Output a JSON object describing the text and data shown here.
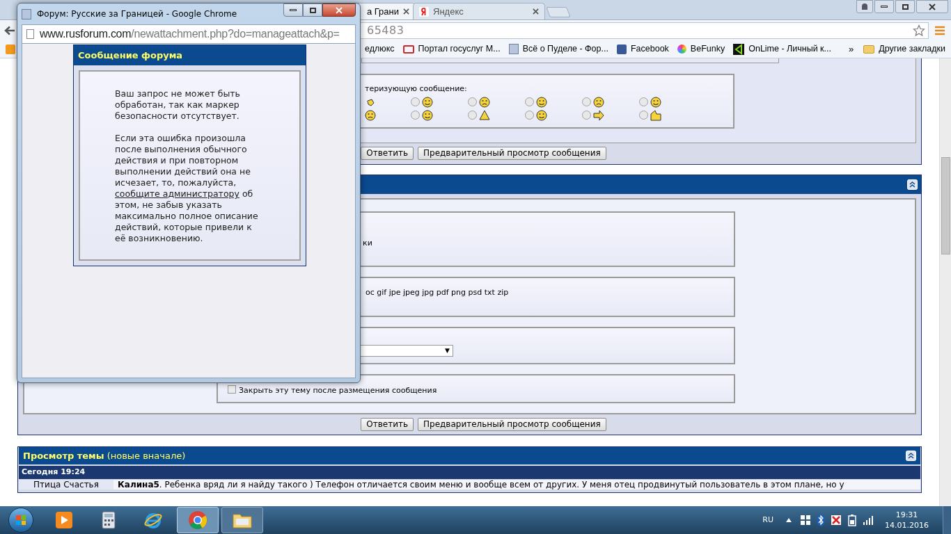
{
  "browser": {
    "tabs": [
      {
        "label": "а Грани",
        "selected": true
      },
      {
        "label": "Яндекс",
        "selected": false
      }
    ],
    "address": "65483",
    "bookmarks": [
      {
        "label": "едлюкс"
      },
      {
        "label": "Портал госуслуг М..."
      },
      {
        "label": "Всё о Пуделе - Фор..."
      },
      {
        "label": "Facebook"
      },
      {
        "label": "BeFunky"
      },
      {
        "label": "OnLime - Личный к..."
      }
    ],
    "bookmarks_more": "»",
    "other_bookmarks": "Другие закладки"
  },
  "reply_form": {
    "smilies_label": "теризующую сообщение:",
    "smilie_radios": [
      {
        "selected": false
      },
      {
        "selected": false
      },
      {
        "selected": false
      },
      {
        "selected": false
      },
      {
        "selected": false
      },
      {
        "selected": false
      },
      {
        "selected": false
      },
      {
        "selected": false
      },
      {
        "selected": false
      },
      {
        "selected": false
      }
    ],
    "buttons": [
      "Ответить",
      "Предварительный просмотр сообщения"
    ]
  },
  "options_panel": {
    "fieldset_1": "ки",
    "fieldset_2": "oc gif jpe jpeg jpg pdf png psd txt zip",
    "select_caret": "▼",
    "close_thread": {
      "label": "Закрыть эту тему после размещения сообщения",
      "checked": false
    },
    "buttons": [
      "Ответить",
      "Предварительный просмотр сообщения"
    ]
  },
  "thread_review": {
    "title": "Просмотр темы",
    "subtitle": "(новые вначале)",
    "date": "Сегодня 19:24",
    "post": {
      "author": "Птица Счастья",
      "text": "**Калина5**. Ребенка вряд ли я найду такого ) Телефон отличается своим меню и вообще всем от других. У меня отец продвинутый пользователь в этом плане, но у"
    }
  },
  "popup": {
    "title": "Форум: Русские за Границей - Google Chrome",
    "url_host": "www.rusforum.com",
    "url_path": "/newattachment.php?do=manageattach&p=",
    "message_title": "Сообщение форума",
    "paragraph_1": "Ваш запрос не может быть обработан, так как маркер безопасности отсутствует.",
    "paragraph_2_before": "Если эта ошибка произошла после выполнения обычного действия и при повторном выполнении действий она не исчезает, то, пожалуйста,",
    "paragraph_2_link": "сообщите администратору",
    "paragraph_2_after": "об этом, не забыв указать максимально полное описание действий, которые привели к её возникновению."
  },
  "taskbar": {
    "language": "RU",
    "time": "19:31",
    "date": "14.01.2016"
  }
}
